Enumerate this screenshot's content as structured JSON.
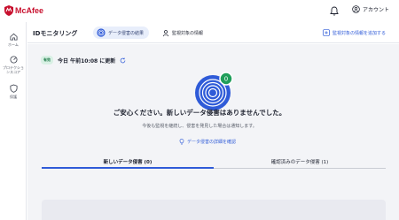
{
  "app": {
    "brand": "McAfee",
    "account_label": "アカウント"
  },
  "sidebar": {
    "items": [
      {
        "label": "ホーム",
        "icon": "home-icon"
      },
      {
        "label": "プロテクションスコア",
        "icon": "protection-score-icon"
      },
      {
        "label": "保護",
        "icon": "shield-icon"
      }
    ]
  },
  "header": {
    "title": "IDモニタリング",
    "tabs": [
      {
        "label": "データ侵害の結果",
        "icon": "fingerprint-icon",
        "active": true
      },
      {
        "label": "監視対象の情報",
        "icon": "person-icon",
        "active": false
      }
    ],
    "add_link": "監視対象の情報を追加する"
  },
  "status": {
    "badge": "有効",
    "updated": "今日 午前10:08 に更新"
  },
  "main": {
    "badge_count": "0",
    "headline": "ご安心ください。新しいデータ侵害はありませんでした。",
    "subtext": "今後も監視を継続し、侵害を発見した場合は通知します。",
    "detail_link": "データ侵害の詳細を確認"
  },
  "bottom_tabs": [
    {
      "label": "新しいデータ侵害 (0)",
      "active": true
    },
    {
      "label": "確認済みのデータ侵害 (1)",
      "active": false
    }
  ],
  "colors": {
    "brand": "#c8102e",
    "accent": "#2f5bd8",
    "hero_blue": "#2f5bd8",
    "success": "#1f9e5a"
  }
}
